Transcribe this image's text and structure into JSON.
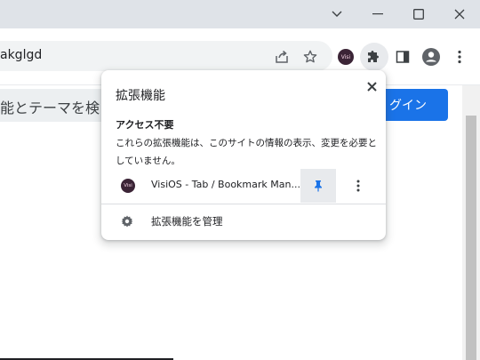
{
  "window": {
    "minimize_icon": "chevron-down-icon",
    "controls": [
      "minimize-icon",
      "maximize-icon",
      "close-icon"
    ]
  },
  "toolbar": {
    "url_fragment": "akglgd",
    "icons": [
      "share-icon",
      "star-icon",
      "visios-extension-icon",
      "puzzle-extensions-icon",
      "side-panel-icon",
      "profile-icon",
      "menu-icon"
    ]
  },
  "page": {
    "search_text": "能とテーマを検",
    "login_label": "グイン",
    "accent": "#1a73e8"
  },
  "popup": {
    "title": "拡張機能",
    "section_heading": "アクセス不要",
    "section_desc": "これらの拡張機能は、このサイトの情報の表示、変更を必要としていません。",
    "extension": {
      "name": "VisiOS - Tab / Bookmark Man...",
      "icon_text": "Visi",
      "pin_color": "#1a73e8"
    },
    "manage_label": "拡張機能を管理"
  }
}
